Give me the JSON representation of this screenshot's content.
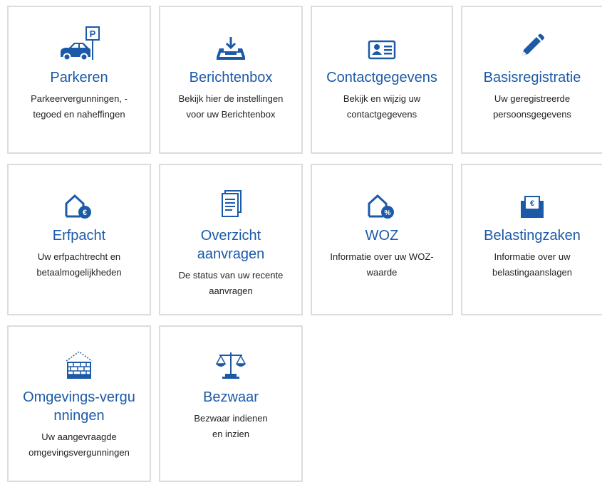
{
  "tiles": [
    {
      "icon": "car-parking-icon",
      "title": "Parkeren",
      "desc": "Parkeervergunningen, -tegoed en naheffingen"
    },
    {
      "icon": "inbox-icon",
      "title": "Berichtenbox",
      "desc": "Bekijk hier de instellingen voor uw Berichtenbox"
    },
    {
      "icon": "contact-card-icon",
      "title": "Contactgegevens",
      "desc": "Bekijk en wijzig uw contactgegevens"
    },
    {
      "icon": "pencil-icon",
      "title": "Basisregistratie",
      "desc": "Uw geregistreerde persoonsgegevens"
    },
    {
      "icon": "house-euro-icon",
      "title": "Erfpacht",
      "desc": "Uw erfpachtrecht en betaalmogelijkheden"
    },
    {
      "icon": "document-stack-icon",
      "title": "Overzicht aanvragen",
      "desc": "De status van uw recente aanvragen"
    },
    {
      "icon": "house-percent-icon",
      "title": "WOZ",
      "desc": "Informatie over uw WOZ-waarde"
    },
    {
      "icon": "envelope-euro-icon",
      "title": "Belastingzaken",
      "desc": "Informatie over uw belastingaanslagen"
    },
    {
      "icon": "brick-house-icon",
      "title": "Omgevings-vergunningen",
      "desc": "Uw aangevraagde omgevingsvergunningen"
    },
    {
      "icon": "scales-icon",
      "title": "Bezwaar",
      "desc": "Bezwaar indienen en inzien"
    }
  ]
}
